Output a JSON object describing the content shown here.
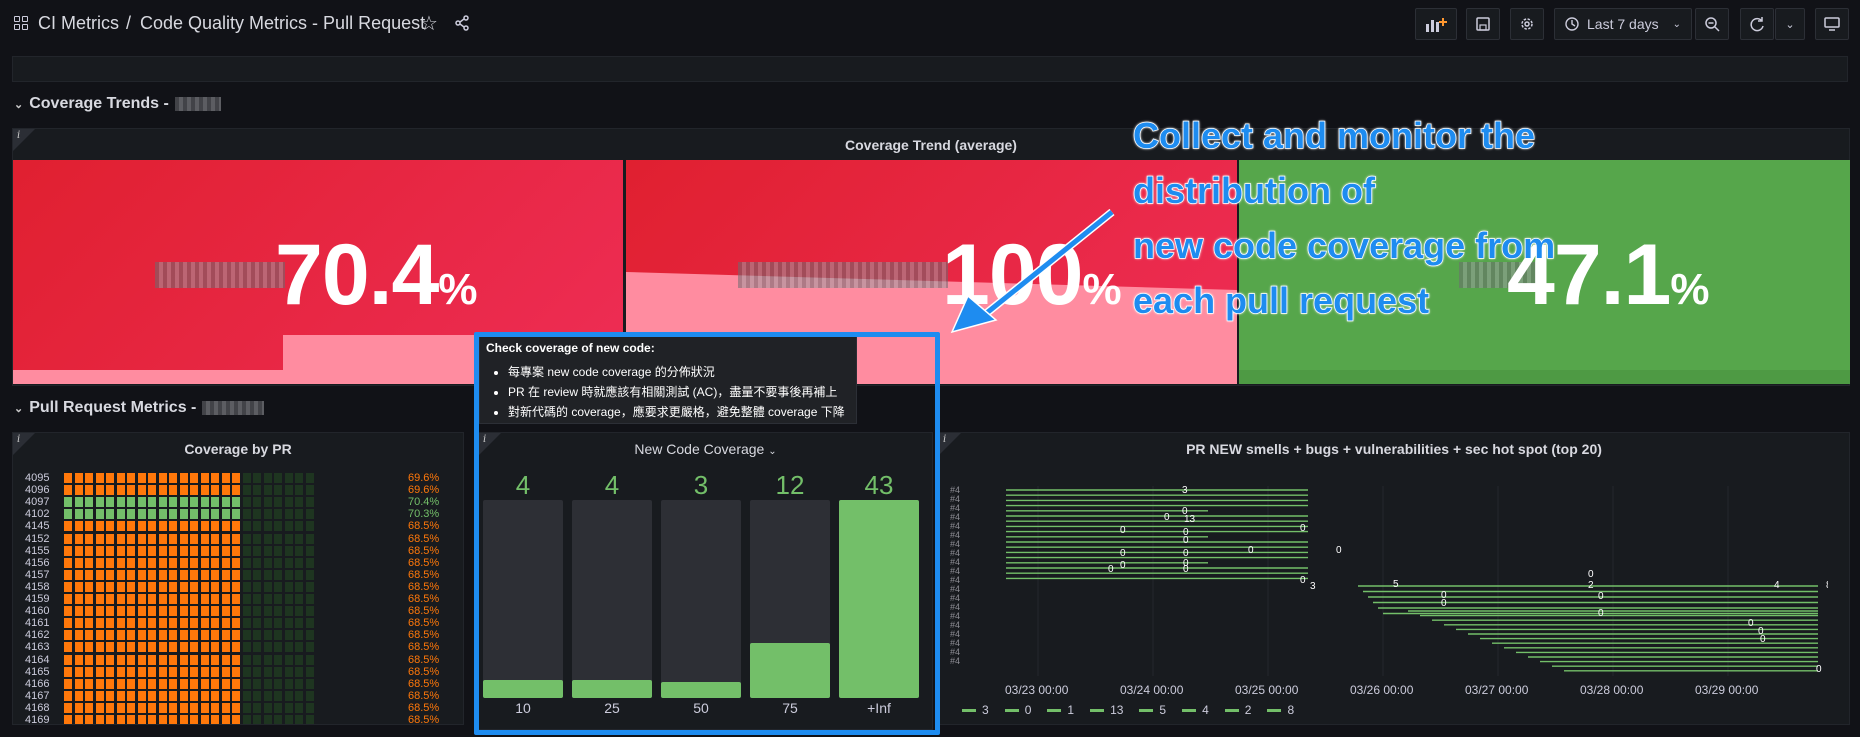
{
  "topbar": {
    "app": "CI Metrics",
    "sep": "/",
    "dashboard": "Code Quality Metrics - Pull Request",
    "time_range": "Last 7 days"
  },
  "rows": {
    "coverage_trends": "Coverage Trends -",
    "pr_metrics": "Pull Request Metrics -"
  },
  "coverage_trend": {
    "title": "Coverage Trend (average)",
    "stats": [
      {
        "value": "70.4",
        "unit": "%",
        "color": "#e8244a"
      },
      {
        "value": "100",
        "unit": "%",
        "color": "#e8244a"
      },
      {
        "value": "47.1",
        "unit": "%",
        "color": "#56a64b"
      }
    ]
  },
  "coverage_by_pr": {
    "title": "Coverage by PR",
    "rows": [
      {
        "pr": "4095",
        "pct": "69.6%",
        "color": "#ff780a"
      },
      {
        "pr": "4096",
        "pct": "69.6%",
        "color": "#ff780a"
      },
      {
        "pr": "4097",
        "pct": "70.4%",
        "color": "#73bf69"
      },
      {
        "pr": "4102",
        "pct": "70.3%",
        "color": "#73bf69"
      },
      {
        "pr": "4145",
        "pct": "68.5%",
        "color": "#ff780a"
      },
      {
        "pr": "4152",
        "pct": "68.5%",
        "color": "#ff780a"
      },
      {
        "pr": "4155",
        "pct": "68.5%",
        "color": "#ff780a"
      },
      {
        "pr": "4156",
        "pct": "68.5%",
        "color": "#ff780a"
      },
      {
        "pr": "4157",
        "pct": "68.5%",
        "color": "#ff780a"
      },
      {
        "pr": "4158",
        "pct": "68.5%",
        "color": "#ff780a"
      },
      {
        "pr": "4159",
        "pct": "68.5%",
        "color": "#ff780a"
      },
      {
        "pr": "4160",
        "pct": "68.5%",
        "color": "#ff780a"
      },
      {
        "pr": "4161",
        "pct": "68.5%",
        "color": "#ff780a"
      },
      {
        "pr": "4162",
        "pct": "68.5%",
        "color": "#ff780a"
      },
      {
        "pr": "4163",
        "pct": "68.5%",
        "color": "#ff780a"
      },
      {
        "pr": "4164",
        "pct": "68.5%",
        "color": "#ff780a"
      },
      {
        "pr": "4165",
        "pct": "68.5%",
        "color": "#ff780a"
      },
      {
        "pr": "4166",
        "pct": "68.5%",
        "color": "#ff780a"
      },
      {
        "pr": "4167",
        "pct": "68.5%",
        "color": "#ff780a"
      },
      {
        "pr": "4168",
        "pct": "68.5%",
        "color": "#ff780a"
      },
      {
        "pr": "4169",
        "pct": "68.5%",
        "color": "#ff780a"
      }
    ]
  },
  "tooltip": {
    "title": "Check coverage of new code:",
    "items": [
      "每專案 new code coverage 的分佈狀況",
      "PR 在 review 時就應該有相關測試 (AC)，盡量不要事後再補上",
      "對新代碼的 coverage，應要求更嚴格，避免整體 coverage 下降"
    ]
  },
  "new_code_coverage": {
    "title": "New Code Coverage",
    "buckets": [
      {
        "label": "10",
        "count": "4"
      },
      {
        "label": "25",
        "count": "4"
      },
      {
        "label": "50",
        "count": "3"
      },
      {
        "label": "75",
        "count": "12"
      },
      {
        "label": "+Inf",
        "count": "43"
      }
    ]
  },
  "smells_panel": {
    "title": "PR NEW smells + bugs + vulnerabilities + sec hot spot (top 20)",
    "x_ticks": [
      "03/23 00:00",
      "03/24 00:00",
      "03/25 00:00",
      "03/26 00:00",
      "03/27 00:00",
      "03/28 00:00",
      "03/29 00:00"
    ],
    "legend": [
      "3",
      "0",
      "1",
      "13",
      "5",
      "4",
      "2",
      "8"
    ]
  },
  "annotation": {
    "lines": [
      "Collect and monitor the",
      "distribution of",
      "new code coverage from",
      "each pull request"
    ]
  },
  "chart_data": {
    "type": "bar",
    "title": "New Code Coverage",
    "categories": [
      "10",
      "25",
      "50",
      "75",
      "+Inf"
    ],
    "values": [
      4,
      4,
      3,
      12,
      43
    ]
  }
}
